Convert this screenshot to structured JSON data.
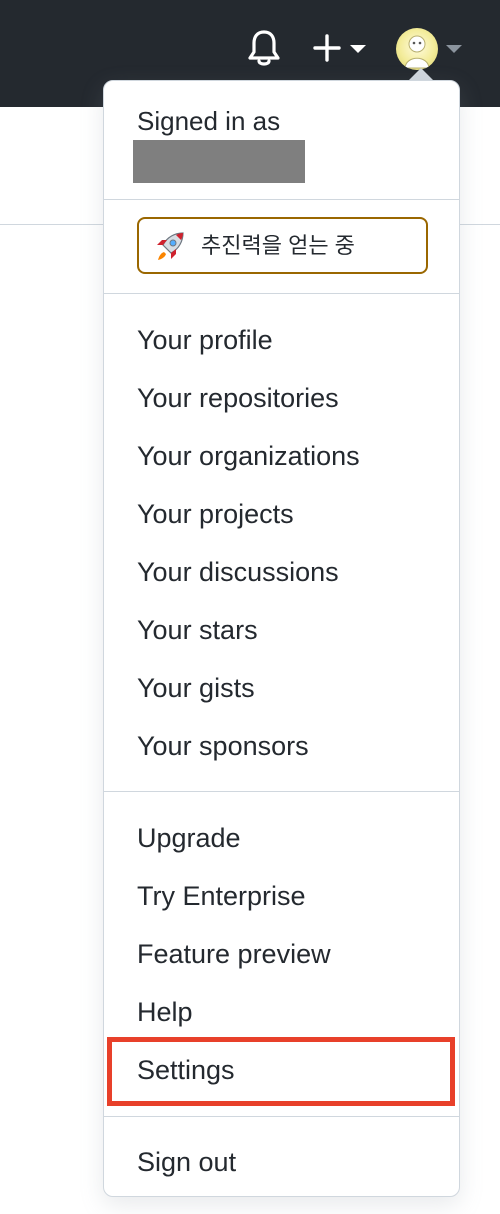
{
  "header": {
    "notifications_icon": "bell-icon",
    "create_icon": "plus-icon",
    "create_caret_icon": "caret-down-icon",
    "avatar_caret_icon": "caret-down-icon",
    "background_color": "#24292f"
  },
  "menu": {
    "signed_in_label": "Signed in as",
    "status_emoji": "rocket-icon",
    "status_text": "추진력을 얻는 중",
    "status_border_color": "#9a6700",
    "group_profile": [
      "Your profile",
      "Your repositories",
      "Your organizations",
      "Your projects",
      "Your discussions",
      "Your stars",
      "Your gists",
      "Your sponsors"
    ],
    "group_help": [
      "Upgrade",
      "Try Enterprise",
      "Feature preview",
      "Help",
      "Settings"
    ],
    "sign_out": "Sign out",
    "highlighted_item": "Settings",
    "highlight_color": "#e8402a"
  }
}
